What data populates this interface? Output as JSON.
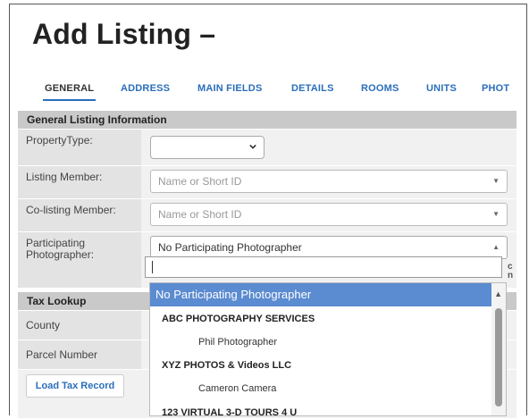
{
  "page": {
    "title": "Add Listing –"
  },
  "tabs": [
    {
      "label": "GENERAL",
      "active": true
    },
    {
      "label": "ADDRESS"
    },
    {
      "label": "MAIN FIELDS"
    },
    {
      "label": "DETAILS"
    },
    {
      "label": "ROOMS"
    },
    {
      "label": "UNITS"
    },
    {
      "label": "PHOT"
    }
  ],
  "general_section": {
    "header": "General Listing Information",
    "property_type": {
      "label": "PropertyType:",
      "value": ""
    },
    "listing_member": {
      "label": "Listing Member:",
      "placeholder": "Name or Short ID"
    },
    "co_listing_member": {
      "label": "Co-listing Member:",
      "placeholder": "Name or Short ID"
    },
    "participating_photographer": {
      "label": "Participating Photographer:",
      "value": "No Participating Photographer",
      "search_value": ""
    }
  },
  "tax_section": {
    "header": "Tax Lookup",
    "county_label": "County",
    "parcel_label": "Parcel Number",
    "load_button": "Load Tax Record"
  },
  "side_truncated": [
    "c",
    "n"
  ],
  "photographer_options": [
    {
      "label": "No Participating Photographer",
      "type": "option",
      "highlighted": true
    },
    {
      "label": "ABC PHOTOGRAPHY SERVICES",
      "type": "group"
    },
    {
      "label": "Phil Photographer",
      "type": "child"
    },
    {
      "label": "XYZ PHOTOS & Videos LLC",
      "type": "group"
    },
    {
      "label": "Cameron Camera",
      "type": "child"
    },
    {
      "label": "123 VIRTUAL 3-D TOURS 4 U",
      "type": "group"
    }
  ],
  "colors": {
    "link": "#2a6ebb",
    "highlight": "#5b8bd0",
    "section_header": "#c9c9c9"
  }
}
